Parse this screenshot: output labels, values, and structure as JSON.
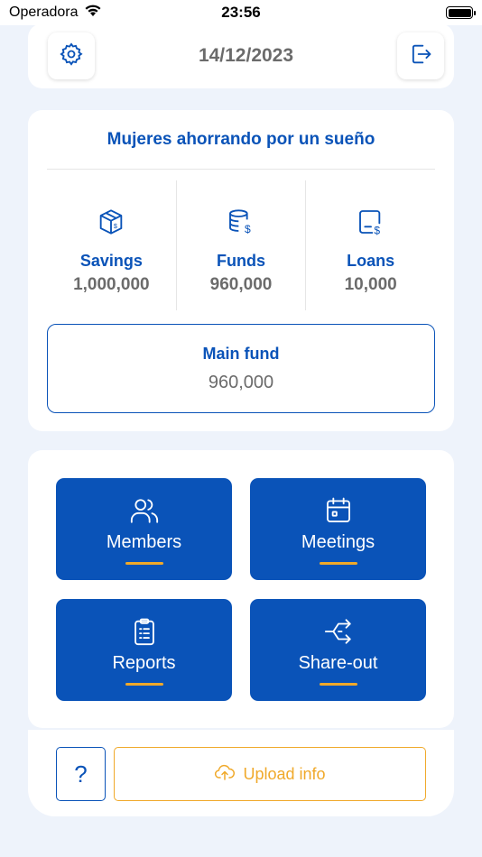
{
  "status_bar": {
    "carrier": "Operadora",
    "time": "23:56"
  },
  "header": {
    "date": "14/12/2023"
  },
  "summary": {
    "group_name": "Mujeres ahorrando por un sueño",
    "stats": [
      {
        "label": "Savings",
        "value": "1,000,000",
        "icon": "savings-box-icon"
      },
      {
        "label": "Funds",
        "value": "960,000",
        "icon": "funds-coins-icon"
      },
      {
        "label": "Loans",
        "value": "10,000",
        "icon": "loans-card-icon"
      }
    ],
    "main_fund": {
      "label": "Main fund",
      "value": "960,000"
    }
  },
  "menu": {
    "tiles": [
      {
        "label": "Members",
        "icon": "members-icon"
      },
      {
        "label": "Meetings",
        "icon": "calendar-icon"
      },
      {
        "label": "Reports",
        "icon": "clipboard-icon"
      },
      {
        "label": "Share-out",
        "icon": "share-out-icon"
      }
    ]
  },
  "footer": {
    "help_label": "?",
    "upload_label": "Upload info"
  },
  "colors": {
    "primary": "#0a53b8",
    "accent": "#f0a92a",
    "muted": "#6b6b6b",
    "background": "#eef3fb"
  }
}
